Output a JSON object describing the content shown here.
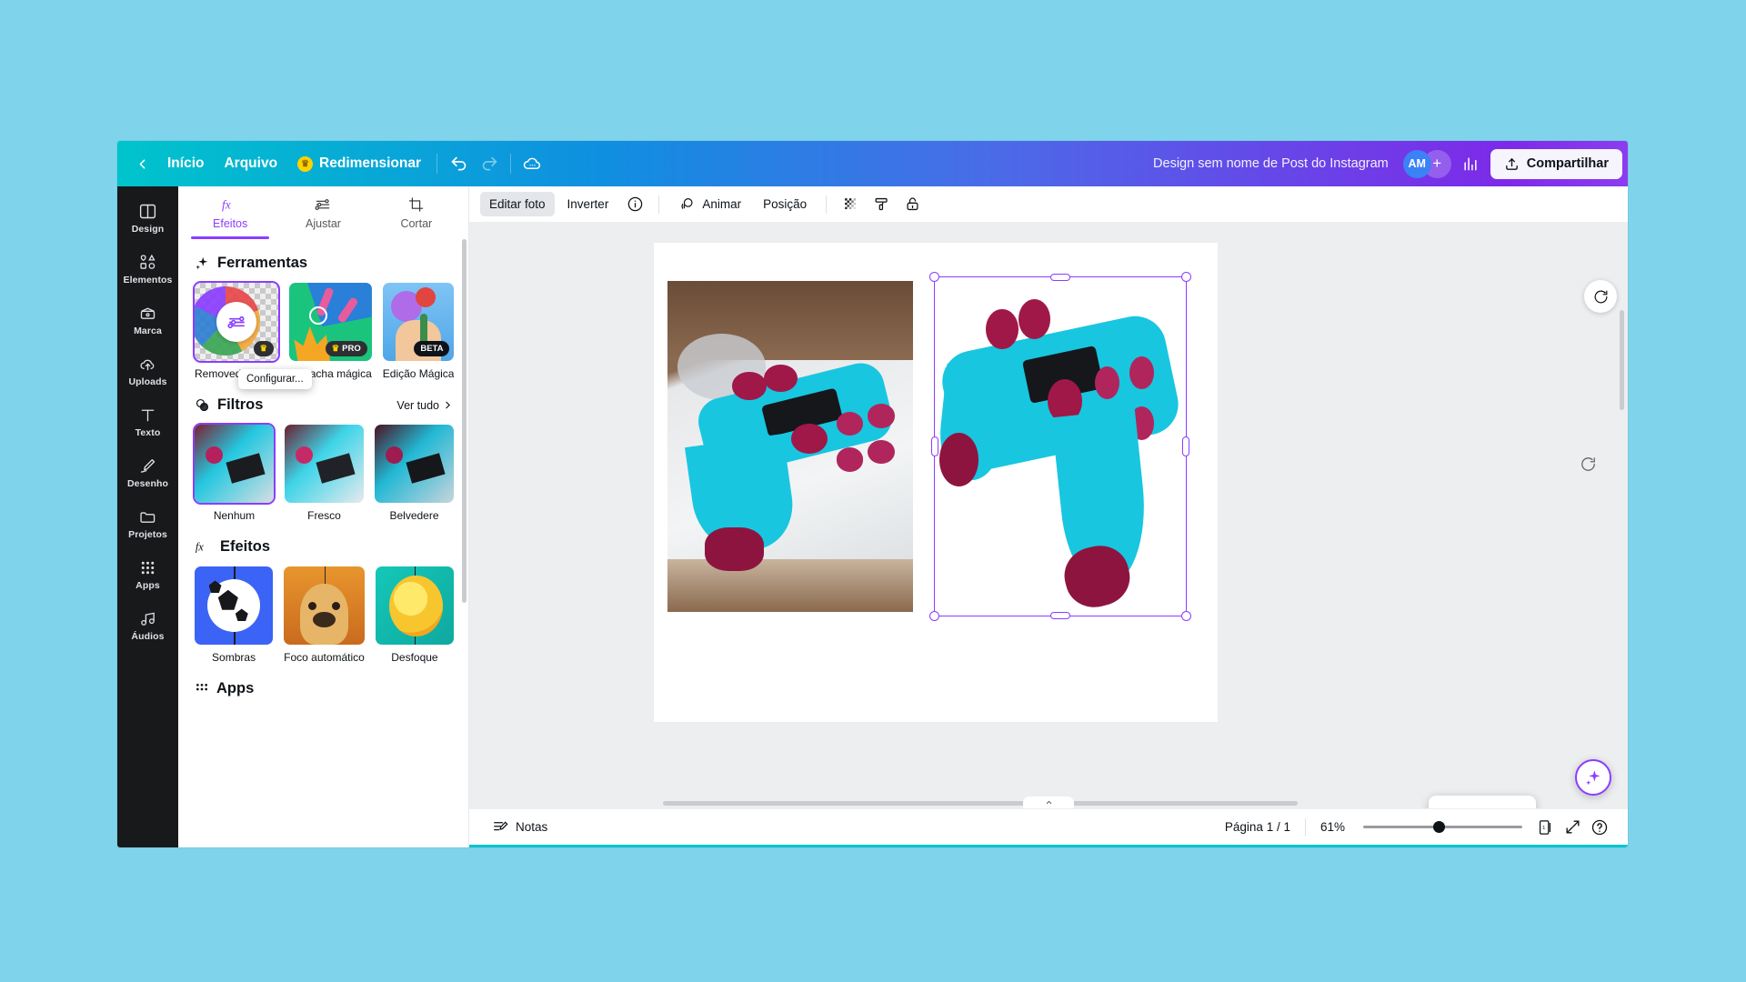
{
  "colors": {
    "brand_start": "#00C4CC",
    "brand_end": "#8B3DFF",
    "accent_purple": "#8B3DFF",
    "page_bg": "#7FD4EC",
    "rail_bg": "#18191B"
  },
  "topbar": {
    "back_icon": "chevron-left-icon",
    "home_label": "Início",
    "file_label": "Arquivo",
    "resize_label": "Redimensionar",
    "crown_icon": "crown-icon",
    "undo_icon": "undo-icon",
    "redo_icon": "redo-icon",
    "cloud_icon": "cloud-saved-icon",
    "doc_title": "Design sem nome de Post do Instagram",
    "avatar_initials": "AM",
    "add_member_label": "+",
    "insights_icon": "bar-chart-icon",
    "share_label": "Compartilhar",
    "share_icon": "share-upload-icon"
  },
  "rail": {
    "items": [
      {
        "label": "Design",
        "icon": "design-layout-icon"
      },
      {
        "label": "Elementos",
        "icon": "elements-shapes-icon"
      },
      {
        "label": "Marca",
        "icon": "brand-kit-icon"
      },
      {
        "label": "Uploads",
        "icon": "upload-cloud-icon"
      },
      {
        "label": "Texto",
        "icon": "text-t-icon"
      },
      {
        "label": "Desenho",
        "icon": "draw-pen-icon"
      },
      {
        "label": "Projetos",
        "icon": "folder-icon"
      },
      {
        "label": "Apps",
        "icon": "apps-grid-icon"
      },
      {
        "label": "Áudios",
        "icon": "audio-note-icon"
      }
    ]
  },
  "panel": {
    "tabs": [
      {
        "label": "Efeitos",
        "icon": "fx-icon",
        "active": true
      },
      {
        "label": "Ajustar",
        "icon": "sliders-icon",
        "active": false
      },
      {
        "label": "Cortar",
        "icon": "crop-icon",
        "active": false
      }
    ],
    "tools_section": {
      "title": "Ferramentas",
      "icon": "sparkle-icon",
      "items": [
        {
          "label": "Removedor de ...",
          "badge": "",
          "selected": true,
          "icon": "sliders-circle-icon"
        },
        {
          "label": "Borracha mágica",
          "badge": "PRO",
          "selected": false,
          "icon": ""
        },
        {
          "label": "Edição Mágica",
          "badge": "BETA",
          "selected": false,
          "icon": ""
        }
      ],
      "tooltip": "Configurar..."
    },
    "filters_section": {
      "title": "Filtros",
      "icon": "filters-icon",
      "see_all": "Ver tudo",
      "chevron_icon": "chevron-right-icon",
      "items": [
        {
          "label": "Nenhum",
          "selected": true
        },
        {
          "label": "Fresco",
          "selected": false
        },
        {
          "label": "Belvedere",
          "selected": false
        }
      ]
    },
    "effects_section": {
      "title": "Efeitos",
      "icon": "fx-icon",
      "items": [
        {
          "label": "Sombras",
          "selected": false
        },
        {
          "label": "Foco automático",
          "selected": false
        },
        {
          "label": "Desfoque",
          "selected": false
        }
      ]
    },
    "apps_section": {
      "title": "Apps",
      "icon": "apps-grid-icon"
    }
  },
  "object_toolbar": {
    "edit_photo_label": "Editar foto",
    "flip_label": "Inverter",
    "info_icon": "info-icon",
    "animate_label": "Animar",
    "animate_icon": "animate-icon",
    "position_label": "Posição",
    "transparency_icon": "transparency-icon",
    "copy_style_icon": "paint-roller-icon",
    "lock_icon": "lock-icon"
  },
  "canvas": {
    "duplicate_icon": "duplicate-icon",
    "delete_icon": "trash-icon",
    "more_icon": "more-horizontal-icon",
    "magic_write_icon": "magic-sparkle-icon",
    "rotate_icon": "rotate-icon",
    "refresh_icon": "refresh-icon"
  },
  "statusbar": {
    "notes_label": "Notas",
    "notes_icon": "notes-icon",
    "page_label": "Página 1 / 1",
    "zoom_level": "61%",
    "pages_icon": "page-grid-icon",
    "fullscreen_icon": "fullscreen-icon",
    "help_icon": "help-icon"
  }
}
